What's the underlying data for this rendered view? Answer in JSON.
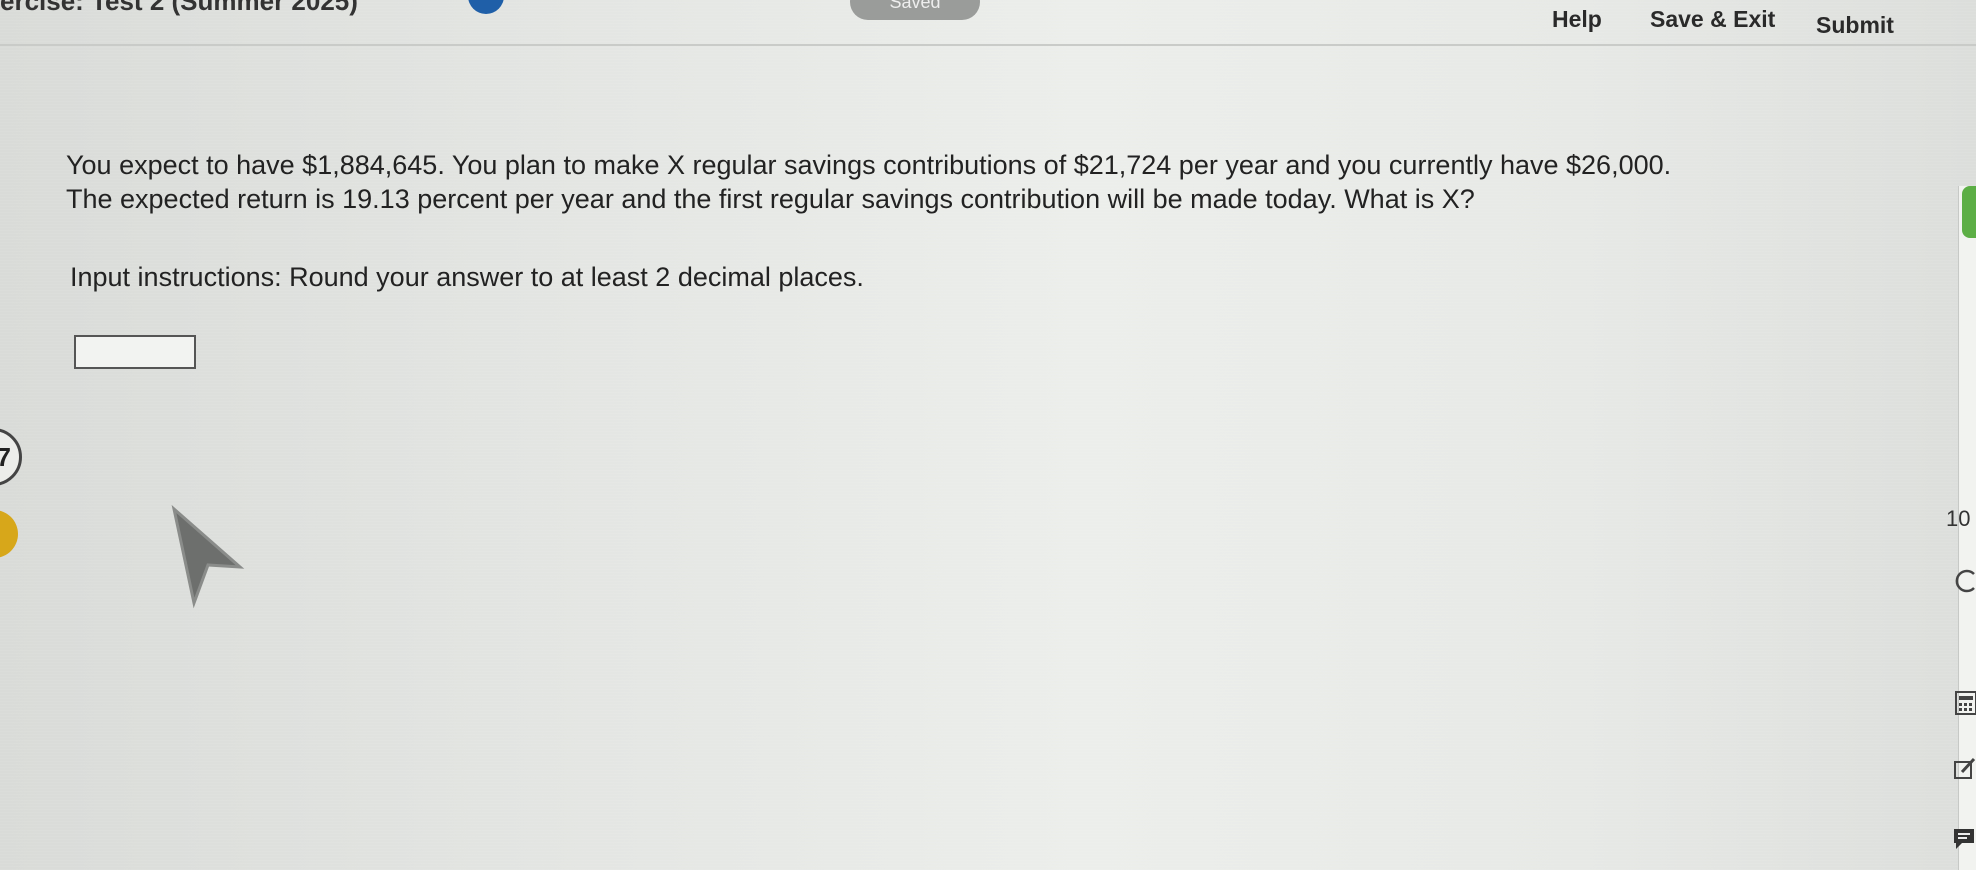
{
  "header": {
    "title_fragment": "ercise: Test 2 (Summer 2025)",
    "saved_label": "Saved",
    "help_label": "Help",
    "save_exit_label": "Save & Exit",
    "submit_label": "Submit"
  },
  "question": {
    "line1": "You expect to have $1,884,645. You plan to make X regular savings contributions of $21,724 per year and you currently have $26,000.",
    "line2": "The expected return is 19.13 percent per year and the first regular savings contribution will be made today. What is X?",
    "instructions": "Input instructions: Round your answer to at least 2 decimal places.",
    "answer_value": ""
  },
  "left_edge": {
    "question_number_fragment": "7"
  },
  "right_edge": {
    "number_fragment": "10",
    "icons": [
      "info-icon",
      "calculator-icon",
      "edit-icon",
      "comment-icon"
    ]
  },
  "colors": {
    "title_badge": "#1f5fa8",
    "progress_green": "#5cae45",
    "flag_yellow": "#d7a71a"
  }
}
